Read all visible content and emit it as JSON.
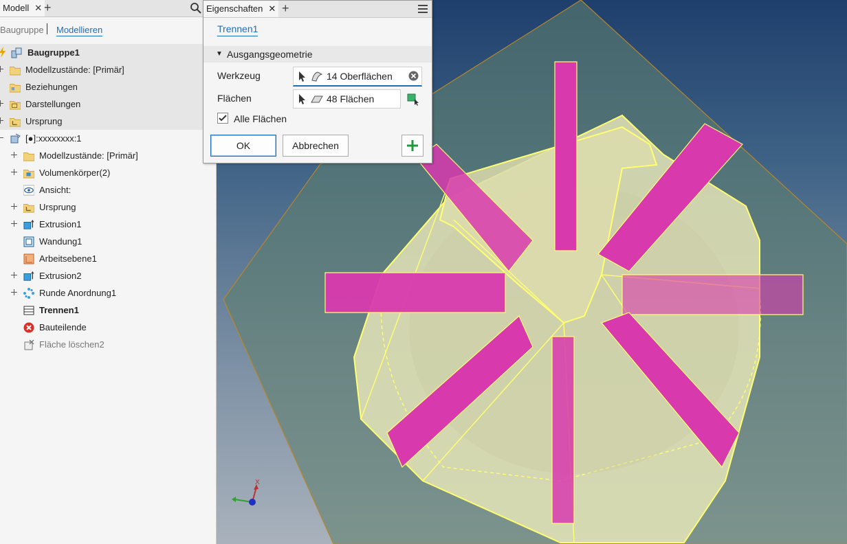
{
  "browser": {
    "tab_label": "Modell",
    "tab_close": "✕",
    "tab_add": "+",
    "mode_assembly": "Baugruppe",
    "mode_modeling": "Modellieren",
    "root": "Baugruppe1",
    "assembly_items": [
      "Modellzustände: [Primär]",
      "Beziehungen",
      "Darstellungen",
      "Ursprung"
    ],
    "part": "[●]:xxxxxxxx:1",
    "part_items": [
      "Modellzustände: [Primär]",
      "Volumenkörper(2)",
      "Ansicht:",
      "Ursprung",
      "Extrusion1",
      "Wandung1",
      "Arbeitsebene1",
      "Extrusion2",
      "Runde Anordnung1",
      "Trennen1",
      "Bauteilende",
      "Fläche löschen2"
    ]
  },
  "properties": {
    "tab_label": "Eigenschaften",
    "tab_close": "✕",
    "tab_add": "+",
    "feature_name": "Trennen1",
    "section_title": "Ausgangsgeometrie",
    "tool_label": "Werkzeug",
    "tool_value": "14 Oberflächen",
    "faces_label": "Flächen",
    "faces_value": "48 Flächen",
    "all_faces_label": "Alle Flächen",
    "all_faces_checked": true,
    "ok_label": "OK",
    "cancel_label": "Abbrechen"
  },
  "viewcube": {
    "x_label": "X"
  },
  "colors": {
    "accent": "#1e6fb8",
    "magenta": "#d03aa8",
    "body": "#e8e8b0",
    "edge": "#ffff66",
    "plane": "#5a7a6a"
  }
}
